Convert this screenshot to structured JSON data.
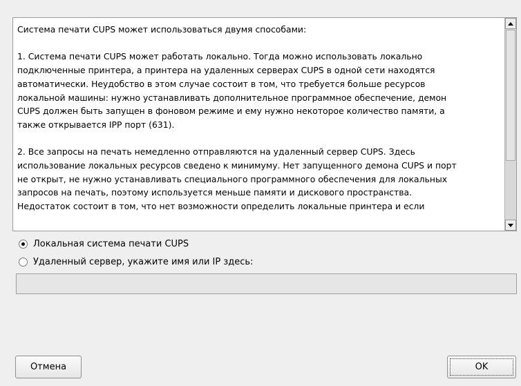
{
  "info": {
    "paragraphs": [
      "Система печати CUPS может использоваться двумя способами:",
      "1. Система печати CUPS может работать локально. Тогда можно использовать локально\nподключенные принтера, а принтера на удаленных серверах CUPS в одной сети находятся\nавтоматически. Неудобство в этом случае состоит в том, что требуется больше ресурсов\nлокальной машины: нужно устанавливать дополнительное программное обеспечение, демон\nCUPS должен быть запущен в фоновом режиме и ему нужно некоторое количество памяти, а\nтакже открывается IPP порт (631).",
      "2. Все запросы на печать немедленно отправляются на удаленный сервер CUPS. Здесь\nиспользование локальных ресурсов сведено к минимуму. Нет запущенного демона CUPS и порт\nне открыт, не нужно устанавливать специального программного обеспечения для локальных\nзапросов на печать, поэтому используется меньше памяти и дискового пространства.\nНедостаток состоит в том, что нет возможности определить локальные принтера и если"
    ]
  },
  "options": {
    "local_label": "Локальная система печати CUPS",
    "remote_label": "Удаленный сервер, укажите имя или IP здесь:",
    "selected": "local"
  },
  "server_input": {
    "value": ""
  },
  "buttons": {
    "cancel": "Отмена",
    "ok": "OK"
  }
}
